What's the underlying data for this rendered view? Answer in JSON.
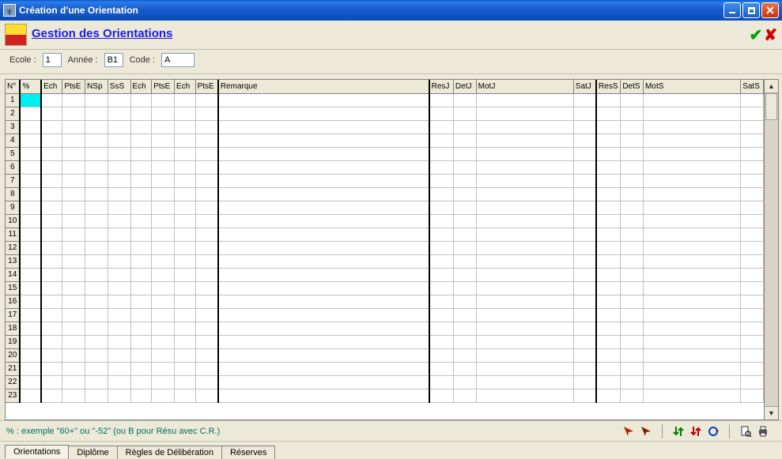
{
  "window": {
    "title": "Création d'une Orientation"
  },
  "header": {
    "title": "Gestion des Orientations"
  },
  "filters": {
    "ecole_label": "Ecole :",
    "ecole_value": "1",
    "annee_label": "Année :",
    "annee_value": "B1",
    "code_label": "Code :",
    "code_value": "A"
  },
  "grid": {
    "columns": [
      {
        "key": "n",
        "label": "N°"
      },
      {
        "key": "pct",
        "label": "%",
        "group_start": true
      },
      {
        "key": "ech1",
        "label": "Ech",
        "group_start": true
      },
      {
        "key": "pts1",
        "label": "PtsE"
      },
      {
        "key": "nsp",
        "label": "NSp"
      },
      {
        "key": "sss",
        "label": "SsS"
      },
      {
        "key": "ech2",
        "label": "Ech"
      },
      {
        "key": "pts2",
        "label": "PtsE"
      },
      {
        "key": "ech3",
        "label": "Ech"
      },
      {
        "key": "pts3",
        "label": "PtsE"
      },
      {
        "key": "rem",
        "label": "Remarque",
        "group_start": true
      },
      {
        "key": "resj",
        "label": "ResJ",
        "group_start": true
      },
      {
        "key": "detj",
        "label": "DetJ"
      },
      {
        "key": "motj",
        "label": "MotJ"
      },
      {
        "key": "satj",
        "label": "SatJ"
      },
      {
        "key": "ress",
        "label": "ResS",
        "group_start": true
      },
      {
        "key": "dets",
        "label": "DetS"
      },
      {
        "key": "mots",
        "label": "MotS"
      },
      {
        "key": "sats",
        "label": "SatS"
      }
    ],
    "row_numbers": [
      1,
      2,
      3,
      4,
      5,
      6,
      7,
      8,
      9,
      10,
      11,
      12,
      13,
      14,
      15,
      16,
      17,
      18,
      19,
      20,
      21,
      22,
      23
    ],
    "selected_row": 0,
    "selected_col": 1
  },
  "hint": {
    "text": "% : exemple \"60+\" ou \"-52\"    (ou B pour Résu avec C.R.)"
  },
  "tabs": {
    "items": [
      {
        "label": "Orientations"
      },
      {
        "label": "Diplôme"
      },
      {
        "label": "Règles de Délibération"
      },
      {
        "label": "Réserves"
      }
    ],
    "active": 0
  }
}
